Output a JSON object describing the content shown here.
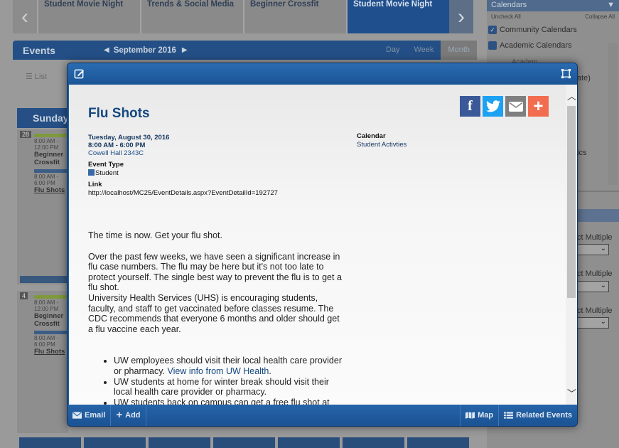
{
  "carousel": {
    "prev_glyph": "‹",
    "next_glyph": "›",
    "tiles": [
      "Student Movie Night",
      "Trends & Social Media",
      "Beginner Crossfit",
      "Student Movie Night"
    ]
  },
  "toolbar": {
    "section": "Events",
    "month_label": "September 2016",
    "views": [
      "Day",
      "Week",
      "Month"
    ],
    "list_label": "List"
  },
  "calendar": {
    "day_header": "Sunday",
    "cells": [
      {
        "day": "28",
        "events": [
          {
            "time": "8:00 AM - 12:00 PM",
            "name": "Beginner Crossfit"
          },
          {
            "time": "8:00 AM - 6:00 PM",
            "name": "Flu Shots"
          }
        ]
      },
      {
        "day": "4",
        "events": [
          {
            "time": "8:00 AM - 12:00 PM",
            "name": "Beginner Crossfit"
          },
          {
            "time": "8:00 AM - 6:00 PM",
            "name": "Flu Shots"
          }
        ]
      }
    ]
  },
  "sidebar": {
    "header": "Calendars",
    "uncheck_all": "Uncheck All",
    "collapse_all": "Collapse All",
    "items": [
      "Community Calendars",
      "Academic Calendars"
    ],
    "partial_texts": [
      "Academ...",
      "ate)",
      "ics"
    ],
    "select_labels": [
      "ct Multiple",
      "ct Multiple",
      "ct Multiple"
    ]
  },
  "modal": {
    "title": "Flu Shots",
    "date": "Tuesday, August 30, 2016",
    "time": "8:00 AM - 6:00 PM",
    "location": "Cowell Hall 2343C",
    "event_type_label": "Event Type",
    "event_type_value": "Student",
    "link_label": "Link",
    "link_value": "http://localhost/MC25/EventDetails.aspx?EventDetailId=192727",
    "calendar_label": "Calendar",
    "calendar_value": "Student Activties",
    "social": [
      "Facebook",
      "Twitter",
      "Email",
      "Add"
    ],
    "description": {
      "p1": "The time is now. Get your flu shot.",
      "p2": "Over the past few weeks, we have seen a significant increase in flu case numbers. The flu may be here but it's not too late to protect yourself. The single best way to prevent the flu is to get a flu shot.",
      "p3": "University Health Services (UHS) is encouraging students, faculty, and staff to get vaccinated before classes resume. The CDC recommends that everyone 6 months and older should get a flu vaccine each year.",
      "bullet1_text": "UW employees should visit their local health care provider or pharmacy.",
      "bullet1_link": "View info from UW Health",
      "bullet2": "UW students at home for winter break should visit their local health care provider or pharmacy.",
      "bullet3": "UW students back on campus can get a free flu shot at"
    },
    "footer": {
      "email": "Email",
      "add": "Add",
      "map": "Map",
      "related": "Related Events"
    }
  },
  "colors": {
    "brand_blue": "#1f5c9d",
    "title_blue": "#14477f",
    "facebook": "#3b5998",
    "twitter": "#1da1f2",
    "email": "#7f7f7f",
    "add": "#f26d4f"
  }
}
